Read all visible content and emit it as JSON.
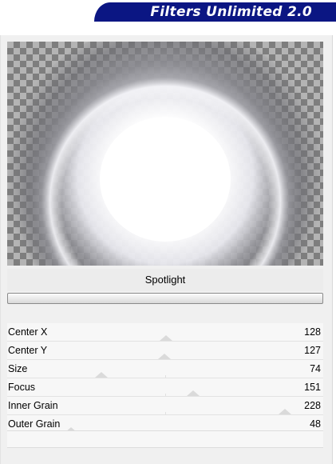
{
  "header": {
    "title": "Filters Unlimited 2.0"
  },
  "preview": {
    "effect": "spotlight"
  },
  "filter": {
    "name": "Spotlight",
    "progress": 0
  },
  "parameters": [
    {
      "label": "Center X",
      "value": 128,
      "max": 255
    },
    {
      "label": "Center Y",
      "value": 127,
      "max": 255
    },
    {
      "label": "Size",
      "value": 74,
      "max": 255
    },
    {
      "label": "Focus",
      "value": 151,
      "max": 255
    },
    {
      "label": "Inner Grain",
      "value": 228,
      "max": 255
    },
    {
      "label": "Outer Grain",
      "value": 48,
      "max": 255
    }
  ],
  "colors": {
    "banner": "#0b1683",
    "panel": "#f0f0f0"
  }
}
